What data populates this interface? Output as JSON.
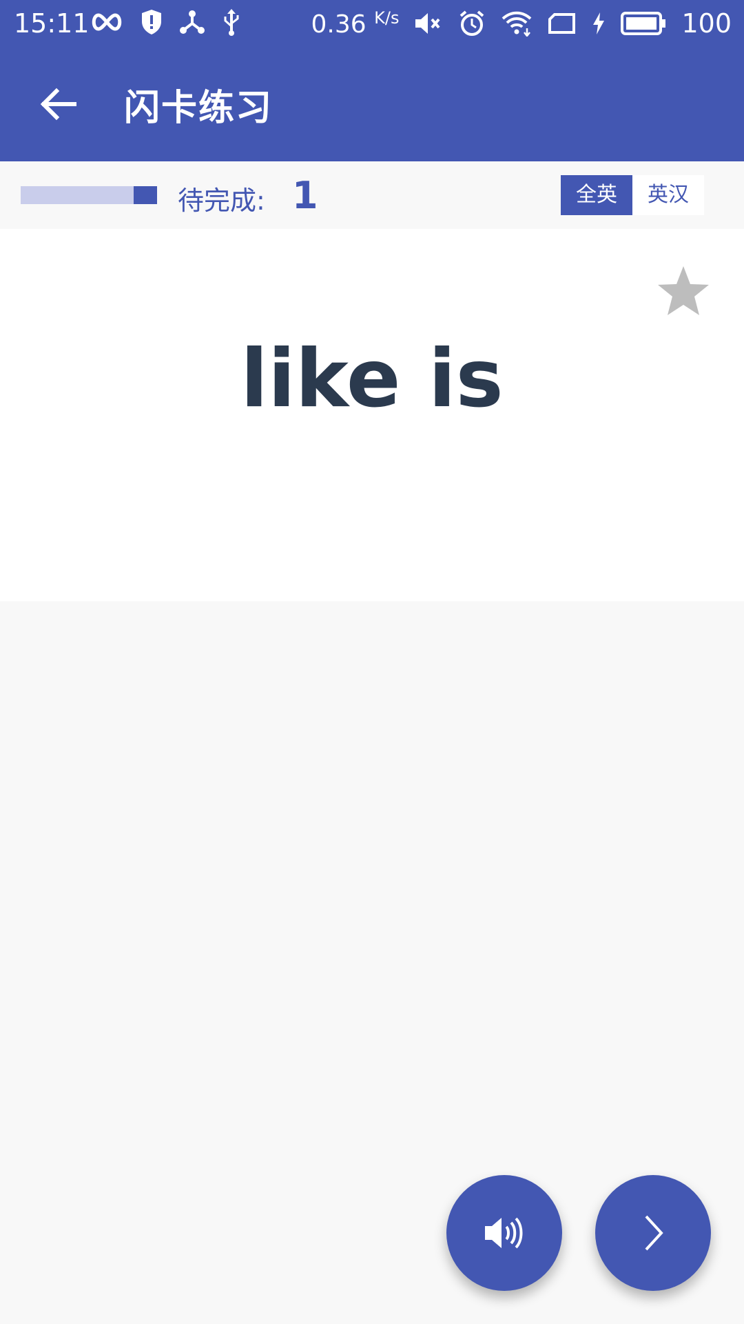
{
  "status_bar": {
    "time": "15:11",
    "speed": "0.36",
    "speed_unit": "K/s",
    "battery": "100"
  },
  "toolbar": {
    "title": "闪卡练习",
    "back_icon": "arrow-left-icon"
  },
  "progress": {
    "label": "待完成:",
    "count": "1",
    "completed_fraction": 0.17
  },
  "mode_toggle": {
    "options": [
      "全英",
      "英汉"
    ],
    "selected": "全英"
  },
  "card": {
    "word": "like is",
    "star_icon": "star-icon"
  },
  "actions": {
    "speak_icon": "speaker-icon",
    "next_icon": "chevron-right-icon"
  },
  "colors": {
    "primary": "#4357B2",
    "progress_track": "#C9CDEB",
    "word_text": "#2B3A4E",
    "star": "#BDBDBD"
  }
}
